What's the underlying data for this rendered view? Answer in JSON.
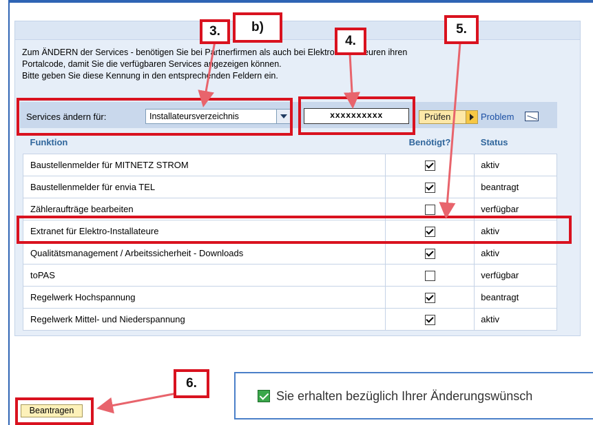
{
  "panel": {
    "intro_lines": [
      "Zum ÄNDERN der Services  - benötigen Sie bei Partnerfirmen als auch bei Elektroinstallateuren ihren",
      "Portalcode, damit Sie die verfügbaren Services angezeigen können.",
      "Bitte geben Sie diese Kennung in den entsprechenden Feldern ein."
    ]
  },
  "services_bar": {
    "label": "Services ändern für:",
    "selected": "Installateursverzeichnis",
    "code_value": "xxxxxxxxxx",
    "check_button": "Prüfen",
    "problem_link": "Problem"
  },
  "table": {
    "headers": [
      "Funktion",
      "Benötigt?",
      "Status"
    ],
    "rows": [
      {
        "function": "Baustellenmelder für MITNETZ STROM",
        "required": true,
        "status": "aktiv"
      },
      {
        "function": "Baustellenmelder für envia TEL",
        "required": true,
        "status": "beantragt"
      },
      {
        "function": "Zähleraufträge bearbeiten",
        "required": false,
        "status": "verfügbar"
      },
      {
        "function": "Extranet für Elektro-Installateure",
        "required": true,
        "status": "aktiv"
      },
      {
        "function": "Qualitätsmanagement / Arbeitssicherheit - Downloads",
        "required": true,
        "status": "aktiv"
      },
      {
        "function": "toPAS",
        "required": false,
        "status": "verfügbar"
      },
      {
        "function": "Regelwerk Hochspannung",
        "required": true,
        "status": "beantragt"
      },
      {
        "function": "Regelwerk Mittel- und Niederspannung",
        "required": true,
        "status": "aktiv"
      }
    ]
  },
  "submit": {
    "label": "Beantragen"
  },
  "message": {
    "text": "Sie erhalten bezüglich Ihrer Änderungswünsch"
  },
  "annotations": {
    "callout_3": "3.",
    "callout_b": "b)",
    "callout_4": "4.",
    "callout_5": "5.",
    "callout_6": "6.",
    "highlight_color": "#d9121f"
  },
  "colors": {
    "frame": "#2f64b4",
    "header_text": "#30669c",
    "button_yellow": "#fde8a8",
    "link": "#1a4ea3"
  }
}
